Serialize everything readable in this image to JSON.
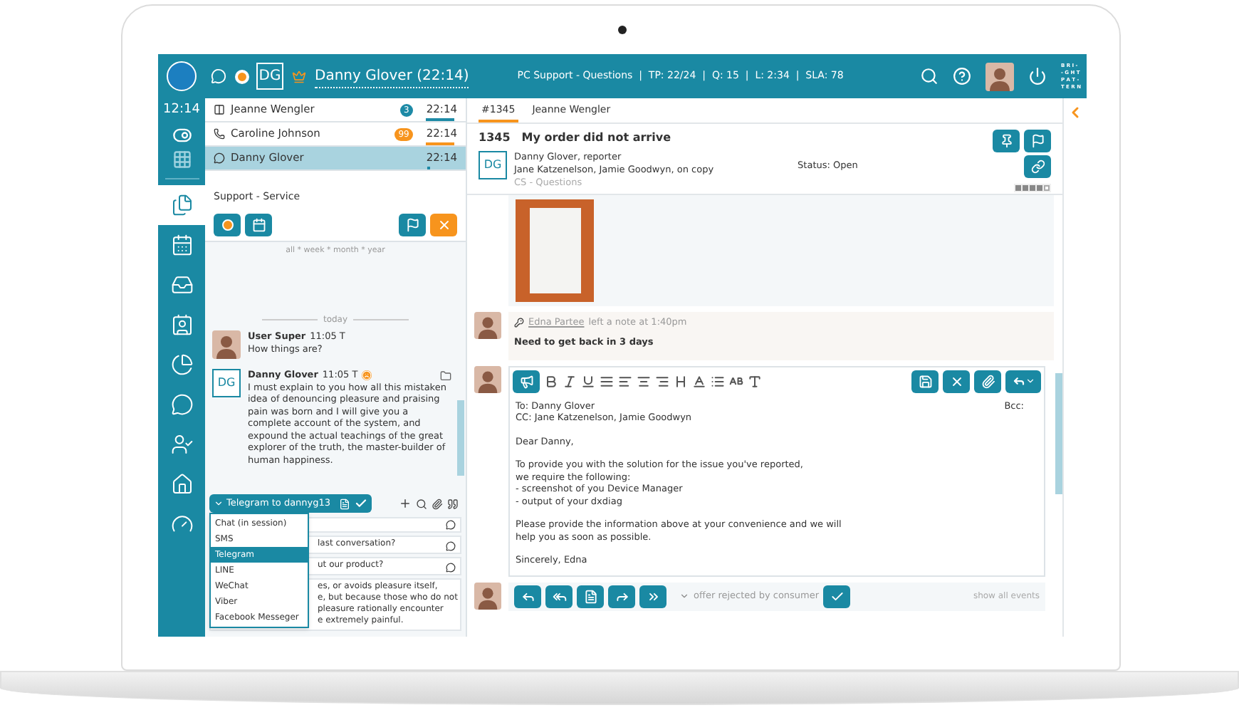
{
  "top_bar": {
    "initials": "DG",
    "contact": "Danny Glover (22:14)",
    "queue_info": "PC Support - Questions  |  TP: 22/24  |  Q: 15  |  L: 2:34  |  SLA: 78",
    "logo_lines": [
      "B R I -",
      "- G H T",
      "P A T -",
      "T E R N"
    ]
  },
  "rail": {
    "clock": "12:14",
    "items": [
      {
        "selected": true
      },
      {
        "selected": false
      },
      {
        "selected": false
      },
      {
        "selected": false
      },
      {
        "selected": false
      },
      {
        "selected": false
      },
      {
        "selected": false
      },
      {
        "selected": false
      },
      {
        "selected": false
      }
    ]
  },
  "conversations": [
    {
      "kind": "messenger",
      "name": "Jeanne Wengler",
      "badge": "3",
      "color": "#1d8aa6",
      "time": "22:14",
      "selected": false
    },
    {
      "kind": "phone",
      "name": "Caroline Johnson",
      "badge": "99",
      "color": "#f7941d",
      "time": "22:14",
      "selected": false
    },
    {
      "kind": "chat",
      "name": "Danny Glover",
      "color": "#1d8aa6",
      "time": "22:14",
      "selected": true
    }
  ],
  "queue": {
    "title": "Support - Service",
    "period": "all * week * month * year"
  },
  "chat": {
    "divider": "today",
    "messages": [
      {
        "kind": "agent",
        "author": "User Super",
        "time": "11:05 T",
        "text": "How things are?"
      },
      {
        "kind": "customer",
        "initials": "DG",
        "author": "Danny Glover",
        "time": "11:05 T",
        "text": "I must explain to you how all this mistaken idea of denouncing pleasure and praising pain was born and I will give you a complete account of the system, and expound the actual teachings of the great explorer of the truth, the master-builder of human happiness."
      }
    ]
  },
  "compose": {
    "channel": "Telegram to dannyg13",
    "menu": [
      {
        "label": "Chat (in session)",
        "selected": false
      },
      {
        "label": "SMS",
        "selected": false
      },
      {
        "label": "Telegram",
        "selected": true
      },
      {
        "label": "LINE",
        "selected": false
      },
      {
        "label": "WeChat",
        "selected": false
      },
      {
        "label": "Viber",
        "selected": false
      },
      {
        "label": "Facebook Messeger",
        "selected": false
      }
    ],
    "snippets": [
      {
        "lines": [
          "last conversation?"
        ]
      },
      {
        "lines": [
          "ut our product?"
        ]
      },
      {
        "lines": [
          "es, or avoids pleasure itself,",
          "e, but because those who do not",
          "pleasure rationally encounter",
          "e extremely painful."
        ]
      }
    ]
  },
  "ticket": {
    "tabs": [
      {
        "label": "#1345",
        "selected": true
      },
      {
        "label": "Jeanne Wengler",
        "selected": false
      }
    ],
    "number": "1345",
    "subject": "My order did not arrive",
    "initials": "DG",
    "reporter": "Danny Glover, reporter",
    "cc": "Jane Katzenelson, Jamie Goodwyn, on copy",
    "category": "CS - Questions",
    "status": "Status: Open",
    "priority": {
      "stars": 4
    }
  },
  "note": {
    "author": "Edna Partee",
    "action": "left a note at 1:40pm",
    "text": "Need to get back in 3 days"
  },
  "editor": {
    "to": "To: Danny Glover",
    "cc": "CC: Jane Katzenelson, Jamie Goodwyn",
    "bcc": "Bcc:",
    "paragraphs": [
      "Dear Danny,",
      "To provide you with the solution for the issue you've reported,\nwe require the following:\n- screenshot of you Device Manager\n- output of your dxdiag",
      "Please provide the information above at your convenience and we will\nhelp you as soon as possible.",
      "Sincerely, Edna"
    ]
  },
  "footer": {
    "status": "offer rejected by consumer",
    "link": "show all events"
  }
}
